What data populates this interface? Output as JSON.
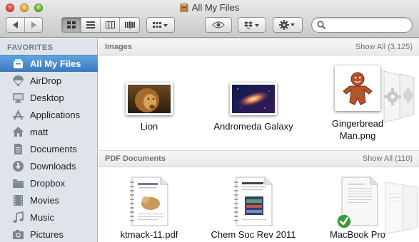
{
  "window": {
    "title": "All My Files"
  },
  "toolbar": {
    "view_modes": [
      "icon-view",
      "list-view",
      "column-view",
      "cover-flow-view"
    ],
    "arrange": "arrange-menu",
    "actions": [
      "quick-look",
      "dropbox-menu",
      "action-menu"
    ]
  },
  "sidebar": {
    "heading": "FAVORITES",
    "items": [
      {
        "label": "All My Files",
        "icon": "all-files-icon",
        "selected": true
      },
      {
        "label": "AirDrop",
        "icon": "airdrop-icon"
      },
      {
        "label": "Desktop",
        "icon": "desktop-icon"
      },
      {
        "label": "Applications",
        "icon": "applications-icon"
      },
      {
        "label": "matt",
        "icon": "home-icon"
      },
      {
        "label": "Documents",
        "icon": "documents-icon"
      },
      {
        "label": "Downloads",
        "icon": "downloads-icon"
      },
      {
        "label": "Dropbox",
        "icon": "folder-icon"
      },
      {
        "label": "Movies",
        "icon": "movies-icon"
      },
      {
        "label": "Music",
        "icon": "music-icon"
      },
      {
        "label": "Pictures",
        "icon": "pictures-icon"
      }
    ]
  },
  "sections": {
    "images": {
      "title": "Images",
      "show_all": "Show All (3,125)",
      "files": [
        {
          "label": "Lion",
          "icon": "lion-thumbnail"
        },
        {
          "label": "Andromeda Galaxy",
          "icon": "galaxy-thumbnail"
        },
        {
          "label_line1": "Gingerbread",
          "label_line2": "Man.png",
          "icon": "gingerbread-thumbnail"
        }
      ]
    },
    "pdfs": {
      "title": "PDF Documents",
      "show_all": "Show All (110)",
      "files": [
        {
          "label": "ktmack-11.pdf",
          "icon": "pdf-thumbnail"
        },
        {
          "label": "Chem Soc Rev 2011",
          "icon": "pdf-thumbnail"
        },
        {
          "label": "MacBook Pro",
          "icon": "pdf-thumbnail"
        }
      ]
    }
  },
  "colors": {
    "selection": "#3b78c3",
    "sidebar_bg": "#dfe4ea",
    "section_text": "#6c747c"
  }
}
